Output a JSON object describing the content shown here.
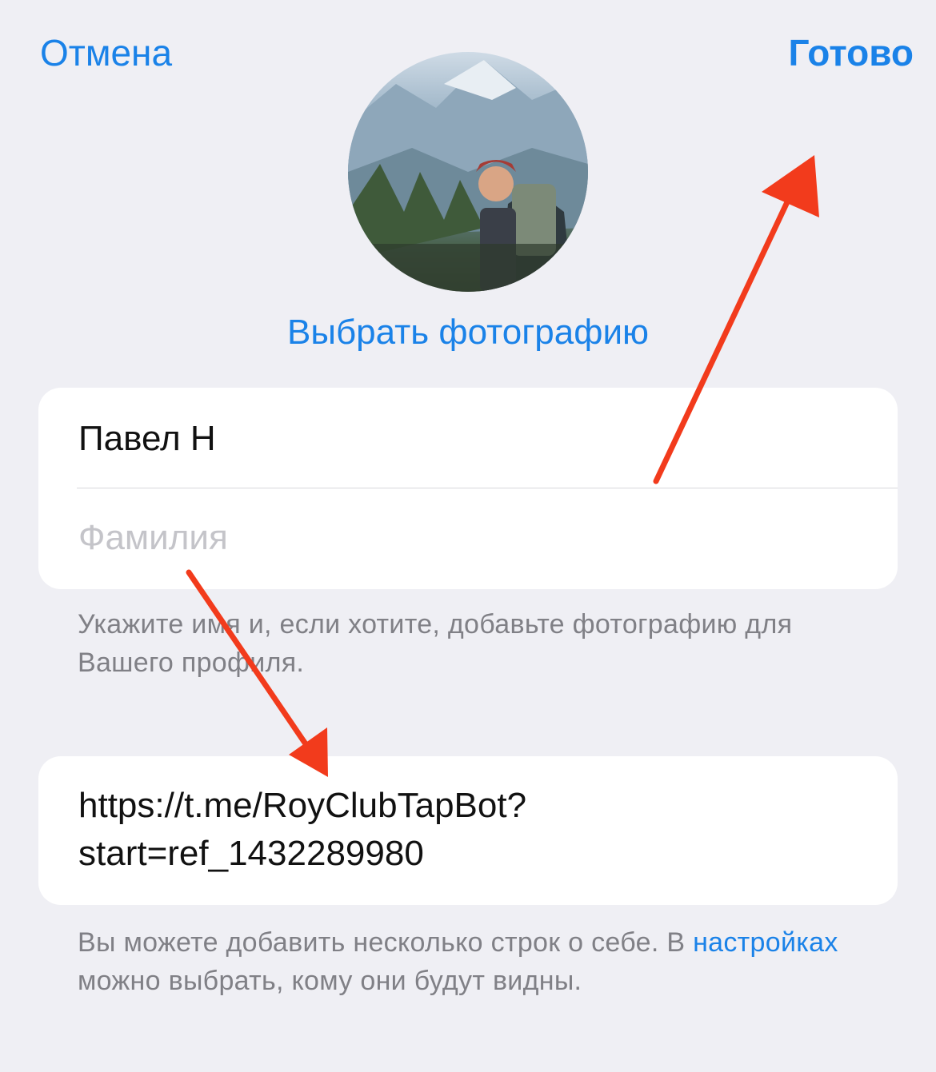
{
  "nav": {
    "cancel_label": "Отмена",
    "done_label": "Готово"
  },
  "profile": {
    "choose_photo_label": "Выбрать фотографию"
  },
  "name_card": {
    "first_name_value": "Павел Н",
    "last_name_placeholder": "Фамилия"
  },
  "hint_name": "Укажите имя и, если хотите, добавьте фотографию для Вашего профиля.",
  "bio": {
    "value_line1": "https://t.me/RoyClubTapBot?",
    "value_line2": "start=ref_1432289980"
  },
  "hint_bio": {
    "before": "Вы можете добавить несколько строк о себе. В ",
    "link": "настройках",
    "after": " можно выбрать, кому они будут видны."
  },
  "colors": {
    "accent": "#1a82e8",
    "annotation_arrow": "#f23b1c",
    "background": "#efeff4"
  }
}
